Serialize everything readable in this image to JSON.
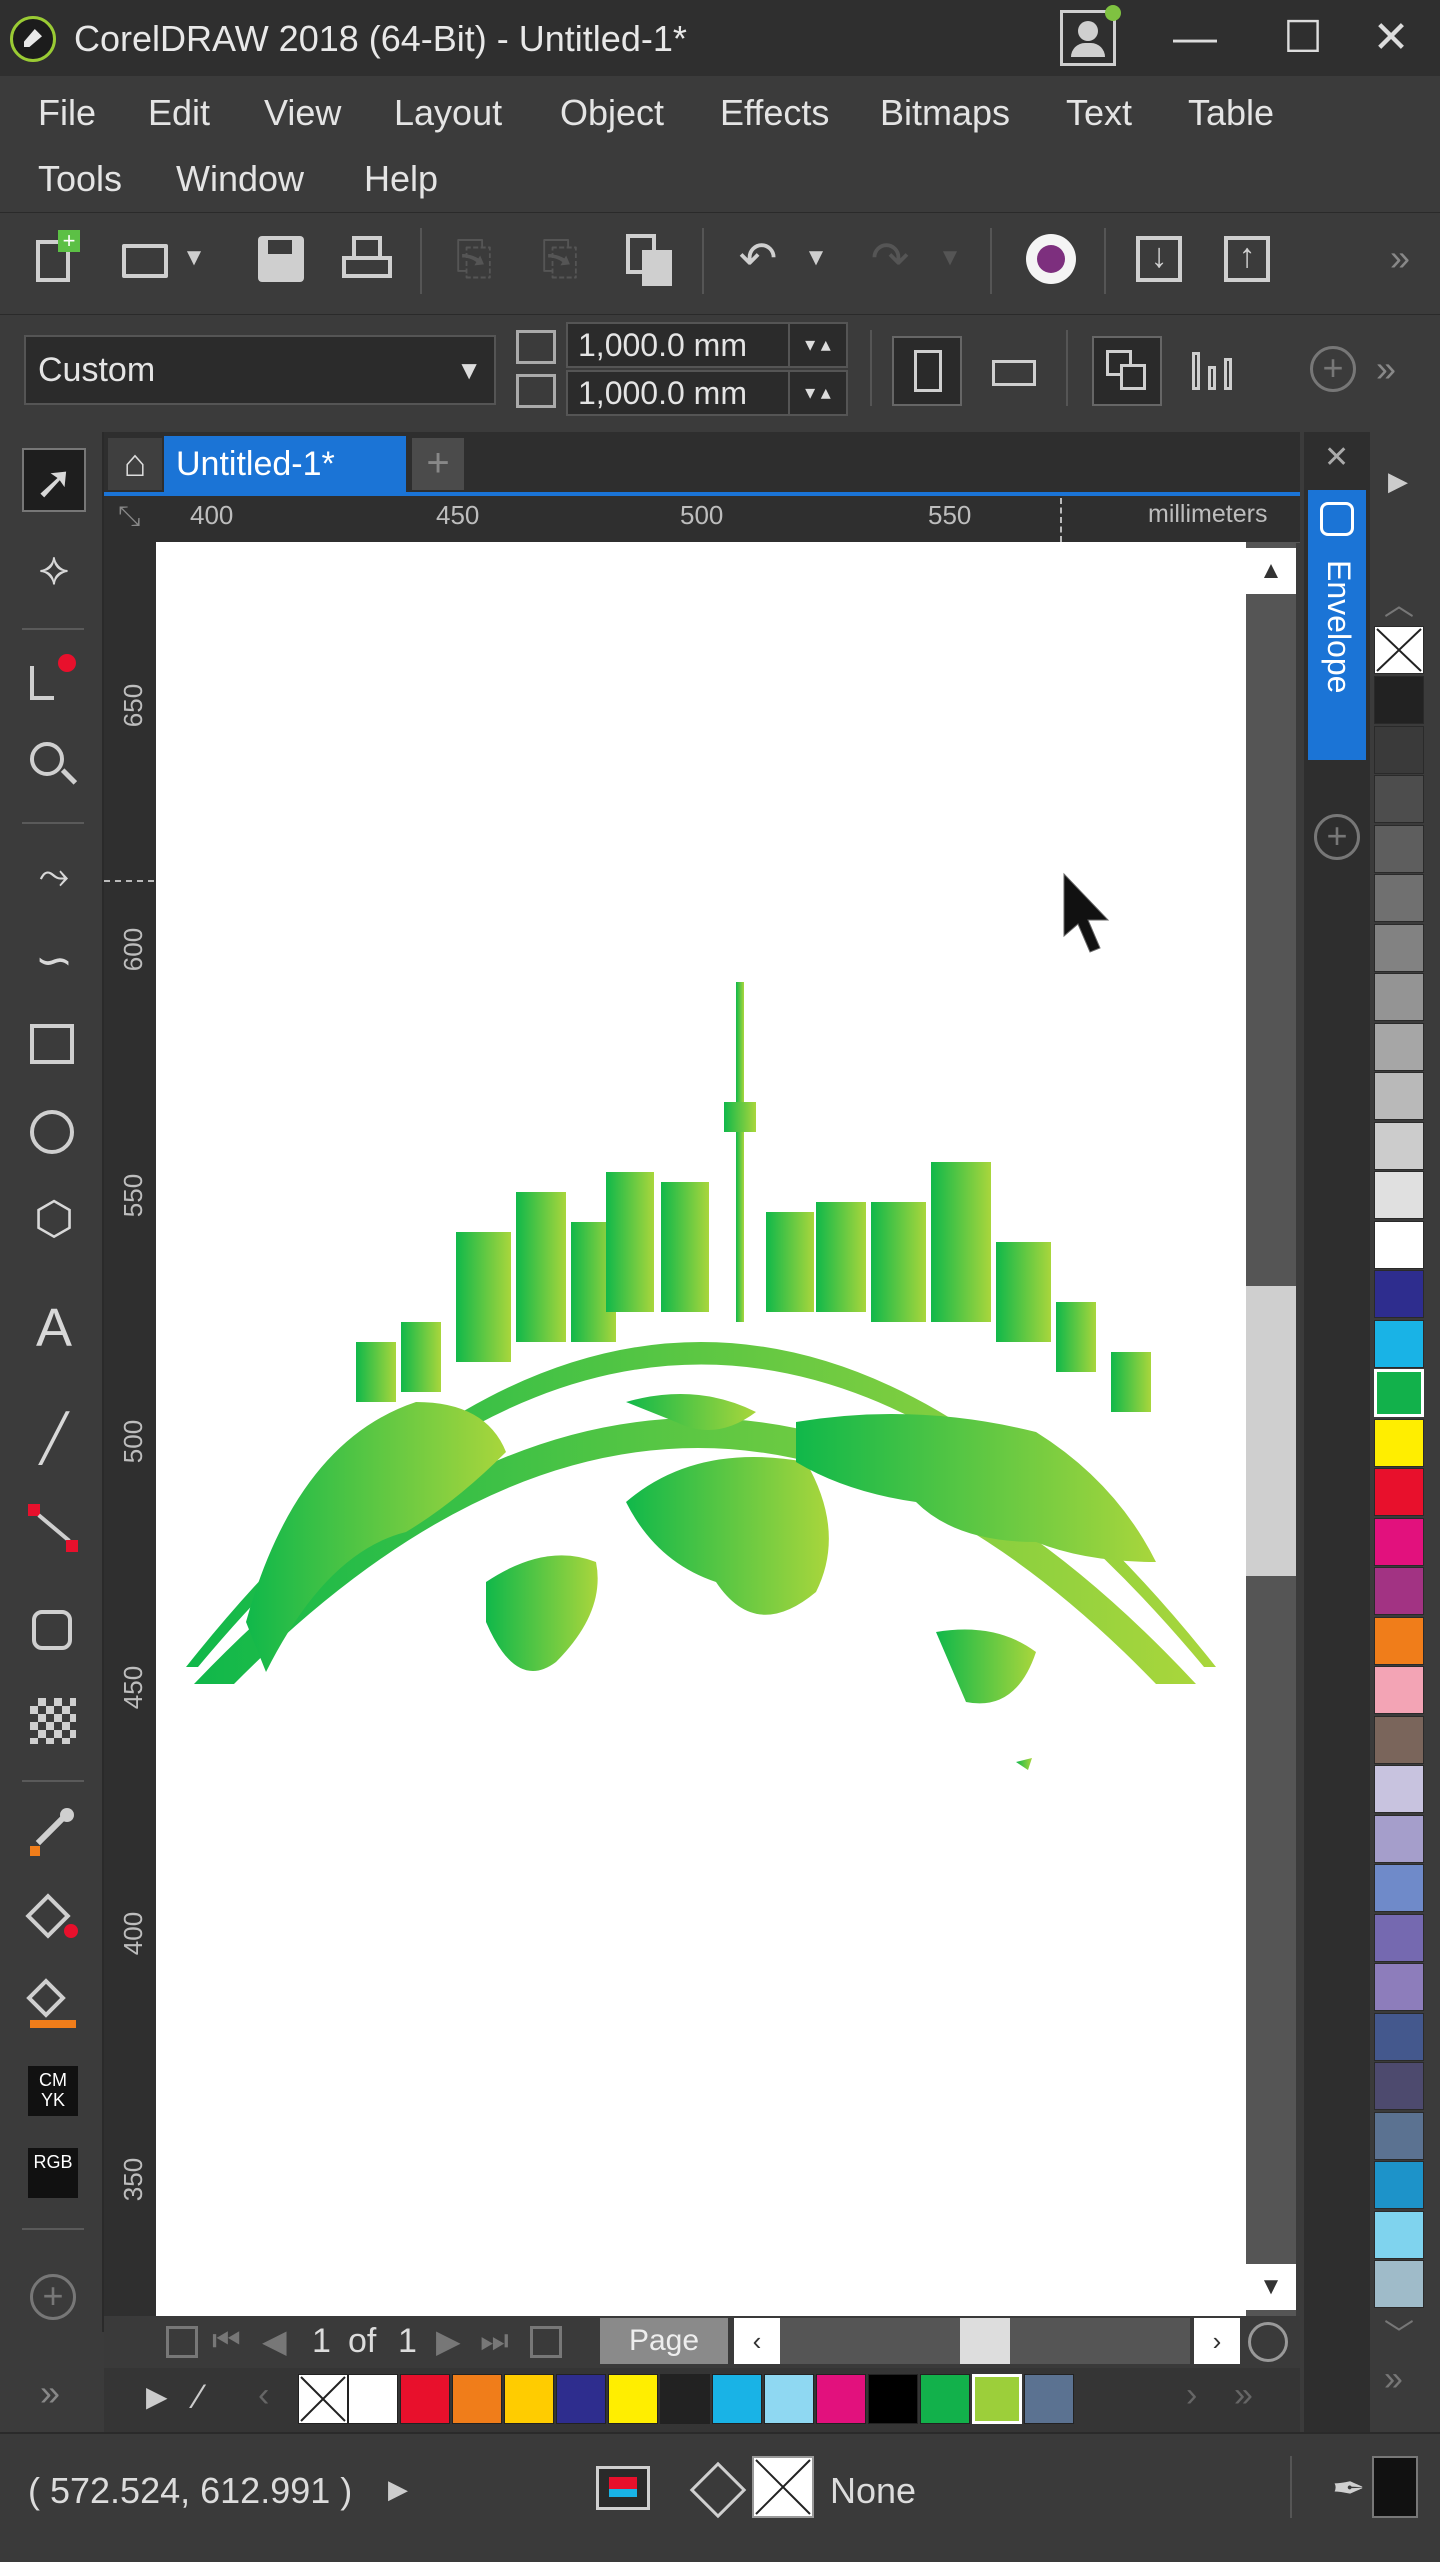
{
  "window": {
    "title": "CorelDRAW 2018 (64-Bit) - Untitled-1*",
    "minimize": "—",
    "maximize": "☐",
    "close": "✕"
  },
  "menu": [
    "File",
    "Edit",
    "View",
    "Layout",
    "Object",
    "Effects",
    "Bitmaps",
    "Text",
    "Table",
    "Tools",
    "Window",
    "Help"
  ],
  "property_bar": {
    "preset": "Custom",
    "width": "1,000.0 mm",
    "height": "1,000.0 mm"
  },
  "document": {
    "tab": "Untitled-1*",
    "ruler_units": "millimeters",
    "ruler_top": [
      "400",
      "450",
      "500",
      "550"
    ],
    "ruler_left": [
      "650",
      "600",
      "550",
      "500",
      "450",
      "400",
      "350"
    ]
  },
  "page_nav": {
    "current": "1",
    "of": "of",
    "total": "1",
    "page_tab": "Page"
  },
  "docker": {
    "envelope_tab": "Envelope"
  },
  "status": {
    "coords": "( 572.524, 612.991 )",
    "fill_label": "None"
  },
  "colors": {
    "accent_blue": "#1b74d6",
    "globe_dark": "#10b84a",
    "globe_light": "#a9d63c"
  },
  "palette": [
    "#ffffff",
    "#e8102c",
    "#f07d1a",
    "#ffcc00",
    "#2e2d8e",
    "#ffee00",
    "#222222",
    "#19b3e6",
    "#8fd8f2",
    "#e2117d",
    "#000000",
    "#12b14b",
    "#9ccf3a",
    "#5b7291"
  ],
  "color_strip": [
    "#222222",
    "#3a3a3a",
    "#4d4d4d",
    "#5e5e5e",
    "#707070",
    "#828282",
    "#949494",
    "#a6a6a6",
    "#b9b9b9",
    "#cccccc",
    "#e0e0e0",
    "#ffffff",
    "#2e2d8e",
    "#19b3e6",
    "#12b14b",
    "#ffee00",
    "#e8102c",
    "#e2117d",
    "#a23383",
    "#f07d1a",
    "#f3a4b5",
    "#7a655b",
    "#c8c3df",
    "#a59ecb",
    "#6f8ac9",
    "#7569b0",
    "#8d7dbb",
    "#44588d",
    "#4d4a6e",
    "#5b7291",
    "#1d93c9",
    "#7fd3ee",
    "#9fbbc9"
  ]
}
